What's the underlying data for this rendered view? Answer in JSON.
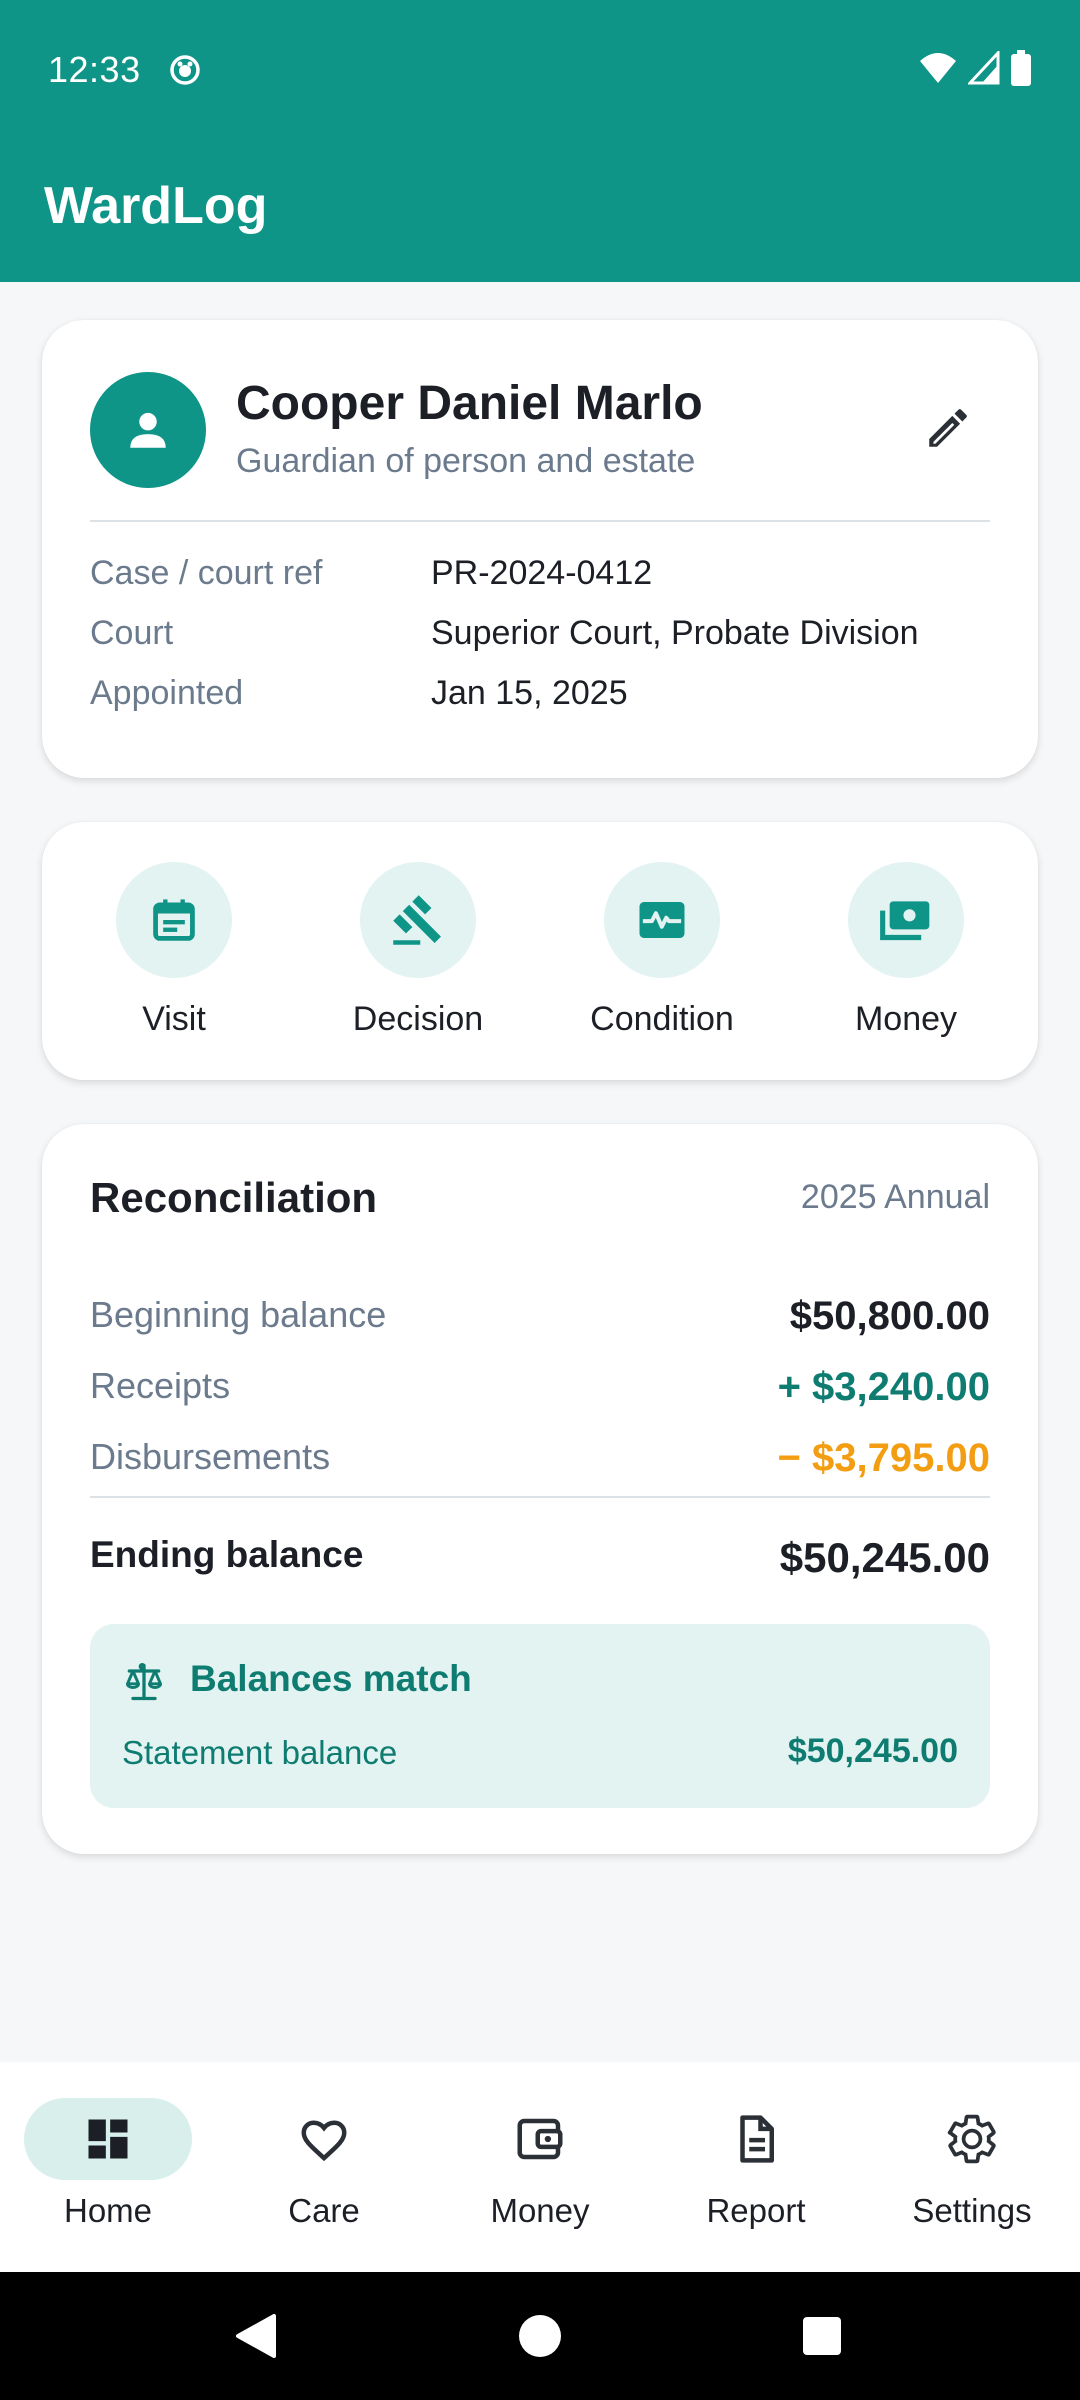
{
  "status_bar": {
    "time": "12:33"
  },
  "app_bar": {
    "title": "WardLog"
  },
  "ward": {
    "name": "Cooper Daniel Marlo",
    "role": "Guardian of person and estate",
    "details": [
      {
        "label": "Case / court ref",
        "value": "PR-2024-0412"
      },
      {
        "label": "Court",
        "value": "Superior Court, Probate Division"
      },
      {
        "label": "Appointed",
        "value": "Jan 15, 2025"
      }
    ]
  },
  "quick_actions": [
    {
      "label": "Visit",
      "icon": "calendar-icon"
    },
    {
      "label": "Decision",
      "icon": "gavel-icon"
    },
    {
      "label": "Condition",
      "icon": "health-monitor-icon"
    },
    {
      "label": "Money",
      "icon": "cash-icon"
    }
  ],
  "reconciliation": {
    "title": "Reconciliation",
    "period": "2025 Annual",
    "rows": [
      {
        "label": "Beginning balance",
        "value": "$50,800.00",
        "color": "#1c1f26"
      },
      {
        "label": "Receipts",
        "value": "+ $3,240.00",
        "color": "#0f7c72"
      },
      {
        "label": "Disbursements",
        "value": "− $3,795.00",
        "color": "#f29d12"
      }
    ],
    "ending": {
      "label": "Ending balance",
      "value": "$50,245.00"
    },
    "match": {
      "title": "Balances match",
      "statement_label": "Statement balance",
      "statement_value": "$50,245.00"
    }
  },
  "bottom_nav": [
    {
      "label": "Home",
      "icon": "dashboard-icon",
      "active": true
    },
    {
      "label": "Care",
      "icon": "heart-icon",
      "active": false
    },
    {
      "label": "Money",
      "icon": "wallet-icon",
      "active": false
    },
    {
      "label": "Report",
      "icon": "document-icon",
      "active": false
    },
    {
      "label": "Settings",
      "icon": "gear-icon",
      "active": false
    }
  ],
  "colors": {
    "brand": "#0f9488",
    "brand_dark": "#0f7c72",
    "warning": "#f29d12",
    "accent_tint": "#e2f3f1"
  }
}
